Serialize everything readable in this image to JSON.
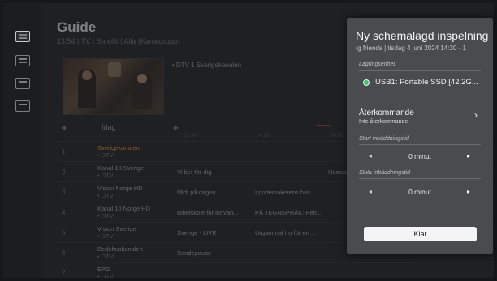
{
  "guide": {
    "title": "Guide",
    "subtitle": "13:54 | TV | Satellit | Alla (Kanalgrupp)",
    "now_channel": "• DTV  1  Sverigekanalen",
    "date_label": "Idag",
    "time_labels": [
      "13:30",
      "14:00",
      "14:30"
    ],
    "now_marker": "Kväll 11",
    "rows": [
      {
        "num": "1",
        "channel": "Sverigekanalen",
        "type": "• DTV",
        "programs": []
      },
      {
        "num": "2",
        "channel": "Kanal 10 Sverige",
        "type": "• DTV",
        "programs": [
          "Vi ber för dig",
          "Homec..."
        ]
      },
      {
        "num": "3",
        "channel": "Visjon Norge HD",
        "type": "• DTV",
        "programs": [
          "Midt på dagen",
          "I pottemakerens hus"
        ]
      },
      {
        "num": "4",
        "channel": "Kanal 10 Norge HD",
        "type": "• DTV",
        "programs": [
          "Bibelskole for innvan...",
          "PÅ TEGNSPRÅK: Perl..."
        ]
      },
      {
        "num": "5",
        "channel": "Vision Sverige",
        "type": "• DTV",
        "programs": [
          "Sverige - LIVE",
          "Urgammal tro för en ..."
        ]
      },
      {
        "num": "6",
        "channel": "Bedehuskanalen",
        "type": "• DTV",
        "programs": [
          "Sendepause"
        ]
      },
      {
        "num": "7",
        "channel": "EPG",
        "type": "• DTV",
        "programs": []
      }
    ]
  },
  "dialog": {
    "title": "Ny schemalagd inspelning",
    "subtitle": "ıg friends | tisdag 4 juni 2024 14:30 - 1",
    "storage_label": "Lagringsenhet",
    "storage_value": "USB1: Portable SSD [42.2G...",
    "recurring_title": "Återkommande",
    "recurring_value": "Inte återkommande",
    "start_label": "Start inbäddningstid",
    "start_value": "0 minut",
    "end_label": "Sluta inbäddningstid",
    "end_value": "0 minut",
    "confirm_label": "Klar"
  },
  "icons": {
    "left": "◂",
    "right": "▸",
    "chevron": "›"
  },
  "colors": {
    "usb_dot": "#2ec865",
    "channel_orange": "#d48a3b",
    "now_red": "#b0323a"
  }
}
